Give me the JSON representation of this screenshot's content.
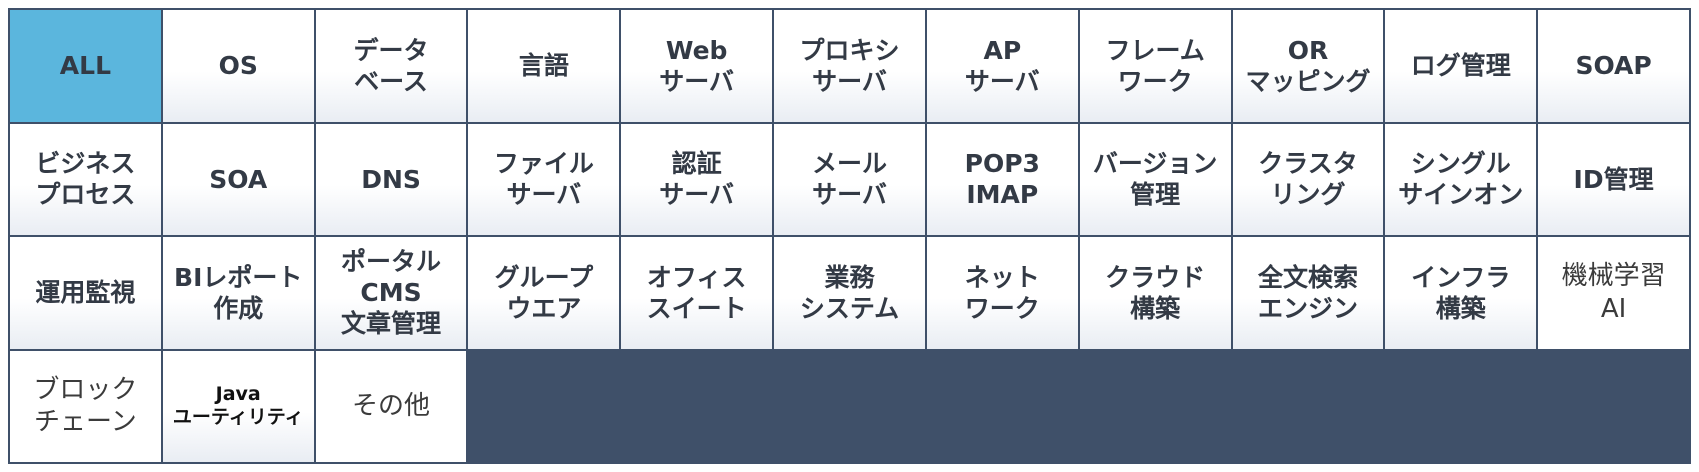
{
  "categories": [
    {
      "label": "ALL",
      "active": true
    },
    {
      "label": "OS"
    },
    {
      "label": "データ\nベース"
    },
    {
      "label": "言語"
    },
    {
      "label": "Web\nサーバ"
    },
    {
      "label": "プロキシ\nサーバ"
    },
    {
      "label": "AP\nサーバ"
    },
    {
      "label": "フレーム\nワーク"
    },
    {
      "label": "OR\nマッピング"
    },
    {
      "label": "ログ管理"
    },
    {
      "label": "SOAP"
    },
    {
      "label": "ビジネス\nプロセス"
    },
    {
      "label": "SOA"
    },
    {
      "label": "DNS"
    },
    {
      "label": "ファイル\nサーバ"
    },
    {
      "label": "認証\nサーバ"
    },
    {
      "label": "メール\nサーバ"
    },
    {
      "label": "POP3\nIMAP"
    },
    {
      "label": "バージョン\n管理"
    },
    {
      "label": "クラスタ\nリング"
    },
    {
      "label": "シングル\nサインオン"
    },
    {
      "label": "ID管理"
    },
    {
      "label": "運用監視"
    },
    {
      "label": "BIレポート\n作成"
    },
    {
      "label": "ポータル\nCMS\n文章管理"
    },
    {
      "label": "グループ\nウエア"
    },
    {
      "label": "オフィス\nスイート"
    },
    {
      "label": "業務\nシステム"
    },
    {
      "label": "ネット\nワーク"
    },
    {
      "label": "クラウド\n構築"
    },
    {
      "label": "全文検索\nエンジン"
    },
    {
      "label": "インフラ\n構築"
    },
    {
      "label": "機械学習\nAI",
      "plain": true
    },
    {
      "label": "ブロック\nチェーン",
      "plain": true
    },
    {
      "label": "Java\nユーティリティ",
      "small": true
    },
    {
      "label": "その他",
      "plain": true
    }
  ]
}
